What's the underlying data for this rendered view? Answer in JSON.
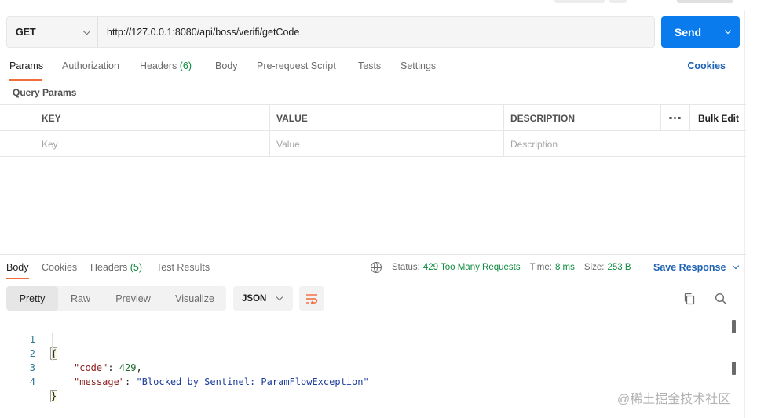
{
  "request": {
    "method": "GET",
    "url": "http://127.0.0.1:8080/api/boss/verifi/getCode",
    "send_label": "Send"
  },
  "request_tabs": {
    "params": "Params",
    "authorization": "Authorization",
    "headers": "Headers",
    "headers_count": "(6)",
    "body": "Body",
    "pre_request_script": "Pre-request Script",
    "tests": "Tests",
    "settings": "Settings",
    "cookies": "Cookies"
  },
  "query_params": {
    "title": "Query Params",
    "columns": {
      "key": "KEY",
      "value": "VALUE",
      "description": "DESCRIPTION",
      "bulk_edit": "Bulk Edit"
    },
    "placeholders": {
      "key": "Key",
      "value": "Value",
      "description": "Description"
    }
  },
  "response_tabs": {
    "body": "Body",
    "cookies": "Cookies",
    "headers": "Headers",
    "headers_count": "(5)",
    "test_results": "Test Results"
  },
  "status": {
    "status_label": "Status:",
    "status_value": "429 Too Many Requests",
    "time_label": "Time:",
    "time_value": "8 ms",
    "size_label": "Size:",
    "size_value": "253 B",
    "save_response": "Save Response"
  },
  "format_bar": {
    "modes": [
      "Pretty",
      "Raw",
      "Preview",
      "Visualize"
    ],
    "active_mode": "Pretty",
    "language": "JSON"
  },
  "response_body": {
    "line_numbers": [
      "1",
      "2",
      "3",
      "4"
    ],
    "open_brace": "{",
    "close_brace": "}",
    "code_key": "\"code\"",
    "code_value": "429",
    "message_key": "\"message\"",
    "message_value": "\"Blocked by Sentinel: ParamFlowException\""
  },
  "watermark": "@稀土掘金技术社区",
  "colors": {
    "send_button": "#097bed",
    "active_tab_underline": "#f26b3a",
    "link_blue": "#1f63b5",
    "status_green": "#0c8a3e"
  },
  "icons": [
    "chevron-down-icon",
    "more-dots-icon",
    "globe-icon",
    "wrap-lines-icon",
    "copy-icon",
    "search-icon"
  ]
}
